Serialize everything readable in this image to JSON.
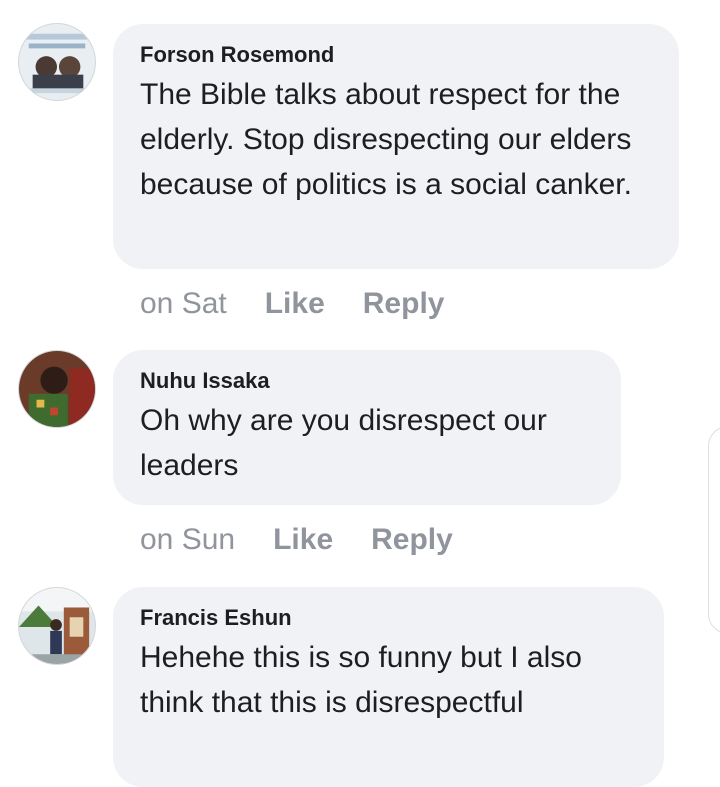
{
  "comments": [
    {
      "author": "Forson Rosemond",
      "text": "The Bible talks about respect for the elderly. Stop disrespecting our elders because of politics is a social canker.",
      "time": "on Sat",
      "like_label": "Like",
      "reply_label": "Reply"
    },
    {
      "author": "Nuhu Issaka",
      "text": "Oh why are you disrespect our leaders",
      "time": "on Sun",
      "like_label": "Like",
      "reply_label": "Reply"
    },
    {
      "author": "Francis Eshun",
      "text": "Hehehe this is so funny but I also think that this is disrespectful"
    }
  ],
  "colors": {
    "bubble_bg": "#f0f2f5",
    "author_text": "#1c1e21",
    "meta_text": "#90949c"
  },
  "icons": [
    "avatar-forson-rosemond",
    "avatar-nuhu-issaka",
    "avatar-francis-eshun"
  ]
}
